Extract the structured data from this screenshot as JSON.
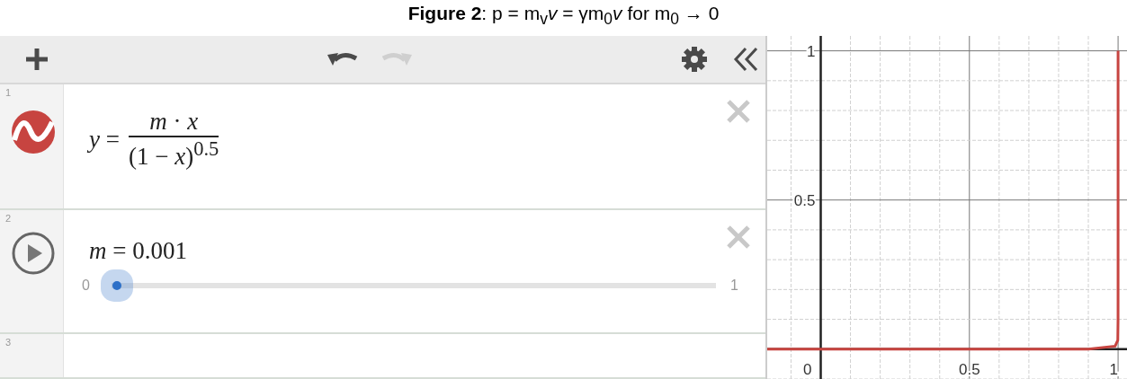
{
  "caption": "**Figure 2**: p = m$_{v}$*v* = γm$_{0}$*v* for m$_{0}$ → 0",
  "toolbar": [
    {
      "kind": "add",
      "disabled": false
    },
    {
      "kind": "undo",
      "disabled": false
    },
    {
      "kind": "redo",
      "disabled": true
    },
    {
      "kind": "settings",
      "disabled": false
    },
    {
      "kind": "collapse",
      "disabled": false
    }
  ],
  "expressions": [
    {
      "kind": "function",
      "number": "1",
      "color": "#c74440",
      "lhs": "*y* =",
      "numerator": "*m* · *x*",
      "denominator": "(1 − *x*)$^{0.5}$"
    },
    {
      "kind": "slider",
      "number": "2",
      "equation": "*m* = 0.001",
      "min": "0",
      "max": "1",
      "level": 0.001
    },
    {
      "kind": "empty",
      "number": "3"
    }
  ],
  "graph": {
    "chart_data": {
      "type": "line",
      "x": [
        -0.18,
        0,
        0.5,
        0.9,
        0.99,
        0.999,
        0.9999,
        0.99999,
        0.999999
      ],
      "series": [
        {
          "color": "#c74440",
          "values": [
            0,
            0,
            0,
            0,
            0.01,
            0.03,
            0.1,
            0.32,
            1.0
          ]
        }
      ],
      "xlim": [
        -0.18,
        1.03
      ],
      "ylim": [
        -0.1,
        1.05
      ],
      "xticks": [
        0,
        0.5,
        1
      ],
      "yticks": [
        0.5,
        1
      ],
      "grid": true
    }
  }
}
